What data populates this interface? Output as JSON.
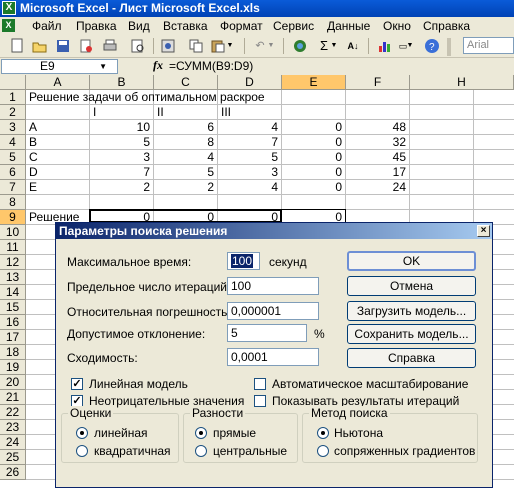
{
  "window": {
    "title": "Microsoft Excel - Лист Microsoft Excel.xls",
    "app_icon": "excel-icon"
  },
  "menu": [
    "Файл",
    "Правка",
    "Вид",
    "Вставка",
    "Формат",
    "Сервис",
    "Данные",
    "Окно",
    "Справка"
  ],
  "toolbar": {
    "font_name": "Arial",
    "sigma": "Σ"
  },
  "formula_bar": {
    "name_box": "E9",
    "fx": "fx",
    "formula": "=СУММ(B9:D9)"
  },
  "columns": [
    "A",
    "B",
    "C",
    "D",
    "E",
    "F",
    "H"
  ],
  "rows": [
    "1",
    "2",
    "3",
    "4",
    "5",
    "6",
    "7",
    "8",
    "9",
    "10",
    "11",
    "12",
    "13",
    "14",
    "15",
    "16",
    "17",
    "18",
    "19",
    "20",
    "21",
    "22",
    "23",
    "24",
    "25",
    "26"
  ],
  "sheet": {
    "r1_title": "Решение задачи об оптимальном раскрое",
    "r2": [
      "I",
      "II",
      "III"
    ],
    "table": [
      {
        "a": "A",
        "b": "10",
        "c": "6",
        "d": "4",
        "e": "0",
        "f": "48"
      },
      {
        "a": "B",
        "b": "5",
        "c": "8",
        "d": "7",
        "e": "0",
        "f": "32"
      },
      {
        "a": "C",
        "b": "3",
        "c": "4",
        "d": "5",
        "e": "0",
        "f": "45"
      },
      {
        "a": "D",
        "b": "7",
        "c": "5",
        "d": "3",
        "e": "0",
        "f": "17"
      },
      {
        "a": "E",
        "b": "2",
        "c": "2",
        "d": "4",
        "e": "0",
        "f": "24"
      }
    ],
    "r9": {
      "a": "Решение",
      "b": "0",
      "c": "0",
      "d": "0",
      "e": "0"
    }
  },
  "dialog": {
    "title": "Параметры поиска решения",
    "close": "×",
    "max_time_label": "Максимальное время:",
    "max_time_value": "100",
    "max_time_unit": "секунд",
    "max_iter_label": "Предельное число итераций:",
    "max_iter_value": "100",
    "precision_label": "Относительная погрешность:",
    "precision_value": "0,000001",
    "tolerance_label": "Допустимое отклонение:",
    "tolerance_value": "5",
    "tolerance_unit": "%",
    "convergence_label": "Сходимость:",
    "convergence_value": "0,0001",
    "buttons": {
      "ok": "OK",
      "cancel": "Отмена",
      "load": "Загрузить модель...",
      "save": "Сохранить модель...",
      "help": "Справка"
    },
    "checkboxes": {
      "linear": {
        "label": "Линейная модель",
        "checked": true
      },
      "nonneg": {
        "label": "Неотрицательные значения",
        "checked": true
      },
      "autoscale": {
        "label": "Автоматическое масштабирование",
        "checked": false
      },
      "show_iter": {
        "label": "Показывать результаты итераций",
        "checked": false
      }
    },
    "groups": {
      "estimates": {
        "title": "Оценки",
        "options": [
          "линейная",
          "квадратичная"
        ],
        "selected": 0
      },
      "derivatives": {
        "title": "Разности",
        "options": [
          "прямые",
          "центральные"
        ],
        "selected": 0
      },
      "search": {
        "title": "Метод поиска",
        "options": [
          "Ньютона",
          "сопряженных градиентов"
        ],
        "selected": 0
      }
    },
    "check_mark": "✓"
  }
}
